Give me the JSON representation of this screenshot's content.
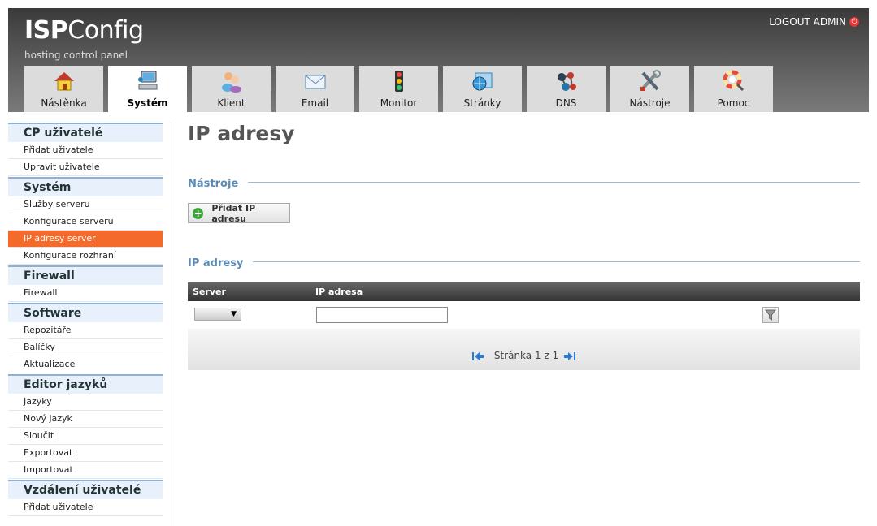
{
  "header": {
    "logo_bold": "ISP",
    "logo_rest": "Config",
    "tagline": "hosting control panel",
    "logout": "LOGOUT ADMIN"
  },
  "tabs": [
    {
      "label": "Nástěnka",
      "icon": "house-icon"
    },
    {
      "label": "Systém",
      "icon": "computer-icon",
      "active": true
    },
    {
      "label": "Klient",
      "icon": "users-icon"
    },
    {
      "label": "Email",
      "icon": "envelope-icon"
    },
    {
      "label": "Monitor",
      "icon": "traffic-light-icon"
    },
    {
      "label": "Stránky",
      "icon": "globe-folder-icon"
    },
    {
      "label": "DNS",
      "icon": "network-nodes-icon"
    },
    {
      "label": "Nástroje",
      "icon": "tools-icon"
    },
    {
      "label": "Pomoc",
      "icon": "lifebuoy-icon"
    }
  ],
  "sidebar": {
    "groups": [
      {
        "title": "CP uživatelé",
        "items": [
          "Přidat uživatele",
          "Upravit uživatele"
        ]
      },
      {
        "title": "Systém",
        "items": [
          "Služby serveru",
          "Konfigurace serveru",
          "IP adresy server",
          "Konfigurace rozhraní"
        ]
      },
      {
        "title": "Firewall",
        "items": [
          "Firewall"
        ]
      },
      {
        "title": "Software",
        "items": [
          "Repozitáře",
          "Balíčky",
          "Aktualizace"
        ]
      },
      {
        "title": "Editor jazyků",
        "items": [
          "Jazyky",
          "Nový jazyk",
          "Sloučit",
          "Exportovat",
          "Importovat"
        ]
      },
      {
        "title": "Vzdálení uživatelé",
        "items": [
          "Přidat uživatele"
        ]
      }
    ],
    "active_item": "IP adresy server"
  },
  "main": {
    "title": "IP adresy",
    "tools_section": "Nástroje",
    "add_button": "Přidat IP adresu",
    "list_section": "IP adresy",
    "columns": [
      "Server",
      "IP adresa"
    ],
    "filter": {
      "server_value": "",
      "ip_value": ""
    },
    "pager_text": "Stránka 1 z 1"
  },
  "colors": {
    "accent": "#f46a2b",
    "section_title": "#5b8bb5",
    "sidebar_group_bg": "#e8f1fb"
  }
}
